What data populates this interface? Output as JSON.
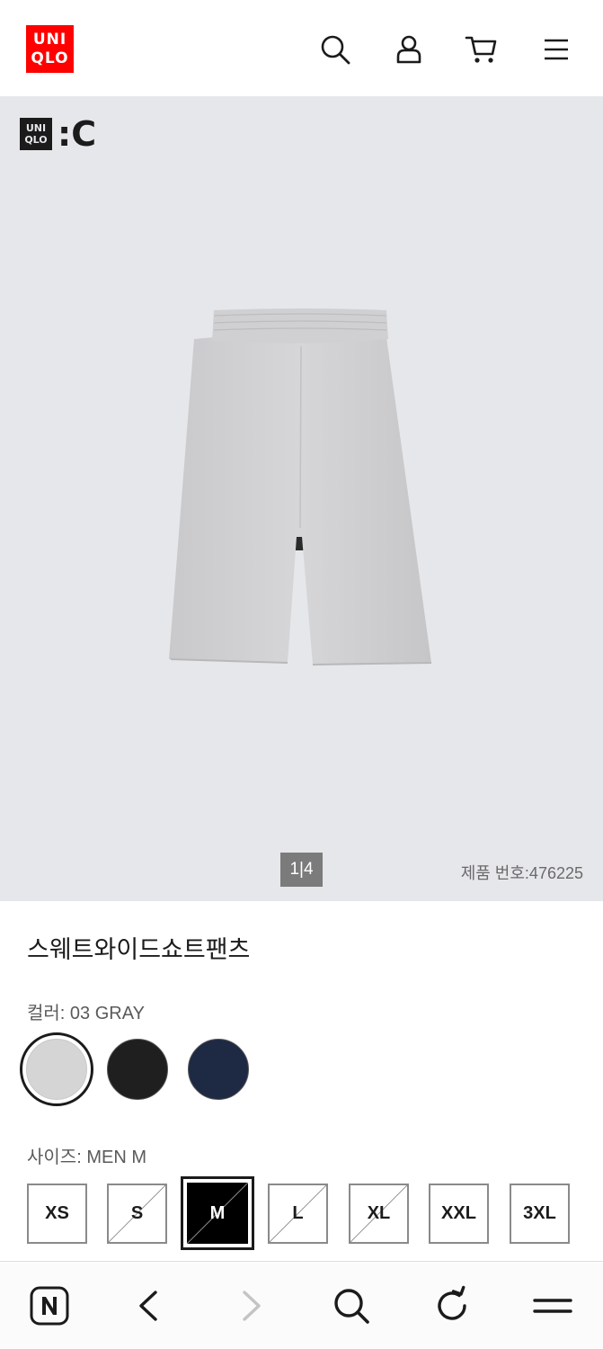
{
  "header": {
    "logo_line1": "UNI",
    "logo_line2": "QLO",
    "icons": [
      "search-icon",
      "account-icon",
      "cart-icon",
      "menu-icon"
    ]
  },
  "hero": {
    "badge_line1": "UNI",
    "badge_line2": "QLO",
    "badge_suffix": ":C",
    "pager": "1|4",
    "product_number": "제품 번호:476225"
  },
  "product": {
    "title": "스웨트와이드쇼트팬츠",
    "color_label": "컬러: 03 GRAY",
    "colors": [
      {
        "name": "03 GRAY",
        "hex": "#d5d5d5",
        "selected": true
      },
      {
        "name": "BLACK",
        "hex": "#1f1f1f",
        "selected": false
      },
      {
        "name": "NAVY",
        "hex": "#1e2a44",
        "selected": false
      }
    ],
    "size_label": "사이즈: MEN M",
    "sizes": [
      {
        "label": "XS",
        "available": true,
        "selected": false
      },
      {
        "label": "S",
        "available": false,
        "selected": false
      },
      {
        "label": "M",
        "available": false,
        "selected": true
      },
      {
        "label": "L",
        "available": false,
        "selected": false
      },
      {
        "label": "XL",
        "available": false,
        "selected": false
      },
      {
        "label": "XXL",
        "available": true,
        "selected": false
      },
      {
        "label": "3XL",
        "available": true,
        "selected": false
      }
    ]
  },
  "browser_bar": {
    "icons": [
      "naver-icon",
      "back-icon",
      "forward-icon",
      "search-icon",
      "refresh-icon",
      "menu-icon"
    ]
  },
  "colors": {
    "brand_red": "#ff0000",
    "hero_bg": "#e6e7ea",
    "text": "#1b1b1b"
  }
}
